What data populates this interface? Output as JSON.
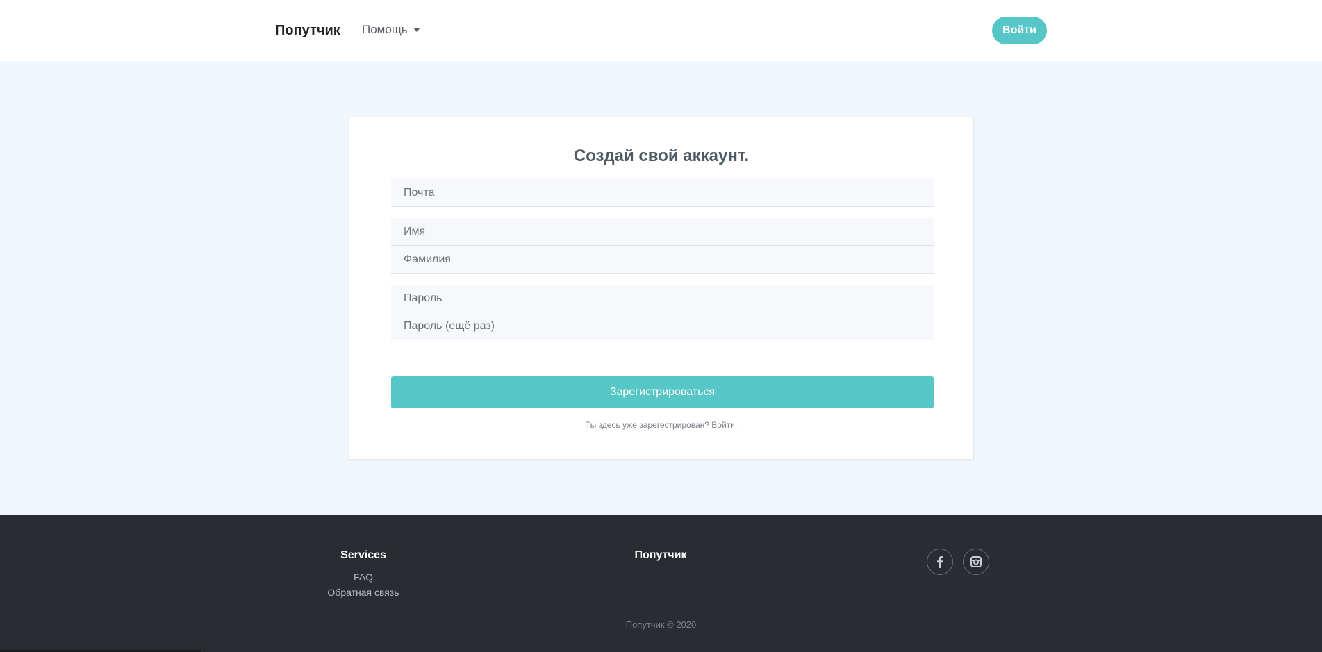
{
  "navbar": {
    "brand": "Попутчик",
    "help_label": "Помощь",
    "login_label": "Войти"
  },
  "signup": {
    "title": "Создай свой аккаунт.",
    "email_placeholder": "Почта",
    "first_name_placeholder": "Имя",
    "last_name_placeholder": "Фамилия",
    "password_placeholder": "Пароль",
    "password_repeat_placeholder": "Пароль (ещё раз)",
    "submit_label": "Зарегистрироваться",
    "already_text": "Ты здесь уже зарегестрирован?",
    "login_link": "Войти."
  },
  "footer": {
    "services_title": "Services",
    "links": [
      "FAQ",
      "Обратная связь"
    ],
    "brand_title": "Попутчик",
    "social": [
      "facebook-icon",
      "instagram-icon"
    ],
    "copyright": "Попутчик © 2020"
  },
  "colors": {
    "accent": "#56c6c6",
    "page_bg": "#f1f6fd",
    "footer_bg": "#292d31"
  }
}
